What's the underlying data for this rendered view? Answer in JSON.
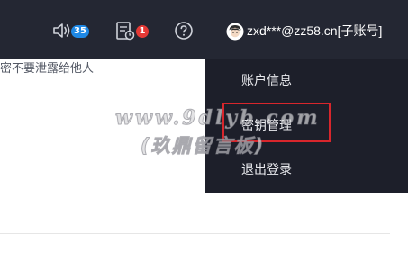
{
  "header": {
    "notifications": {
      "icon": "speaker-icon",
      "count": "35",
      "badge_color": "#1e88e5"
    },
    "tasks": {
      "icon": "document-clock-icon",
      "count": "1",
      "badge_color": "#e53935"
    },
    "help": {
      "icon": "help-icon"
    },
    "user": {
      "icon": "avatar-icon",
      "name": "zxd***@zz58.cn[子账号]"
    }
  },
  "content": {
    "notice_fragment": "密不要泄露给他人"
  },
  "user_menu": {
    "items": [
      {
        "label": "账户信息"
      },
      {
        "label": "密钥管理",
        "highlighted": true,
        "highlight_color": "#d8262c"
      },
      {
        "label": "退出登录"
      }
    ]
  },
  "watermark": {
    "line1": "www.9dlyb.com",
    "line2": "(玖鼎留言板)"
  }
}
